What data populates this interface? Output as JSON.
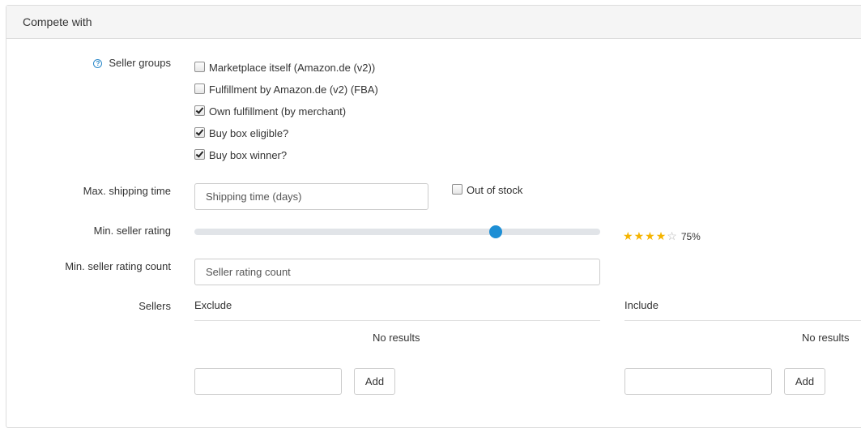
{
  "panel": {
    "title": "Compete with"
  },
  "seller_groups": {
    "label": "Seller groups",
    "help_icon": "question-circle-icon",
    "options": [
      {
        "label": "Marketplace itself (Amazon.de (v2))",
        "checked": false
      },
      {
        "label": "Fulfillment by Amazon.de (v2) (FBA)",
        "checked": false
      },
      {
        "label": "Own fulfillment (by merchant)",
        "checked": true
      },
      {
        "label": "Buy box eligible?",
        "checked": true
      },
      {
        "label": "Buy box winner?",
        "checked": true
      }
    ]
  },
  "shipping": {
    "label": "Max. shipping time",
    "placeholder": "Shipping time (days)",
    "out_of_stock_label": "Out of stock",
    "out_of_stock_checked": false
  },
  "rating": {
    "label": "Min. seller rating",
    "value_percent": 75,
    "value_text": "75%",
    "stars_filled": 4,
    "stars_total": 5,
    "accent_color": "#1e8fd5",
    "star_color": "#f5b400"
  },
  "rating_count": {
    "label": "Min. seller rating count",
    "placeholder": "Seller rating count"
  },
  "sellers": {
    "label": "Sellers",
    "exclude": {
      "title": "Exclude",
      "empty_text": "No results",
      "add_label": "Add"
    },
    "include": {
      "title": "Include",
      "empty_text": "No results",
      "add_label": "Add"
    }
  }
}
